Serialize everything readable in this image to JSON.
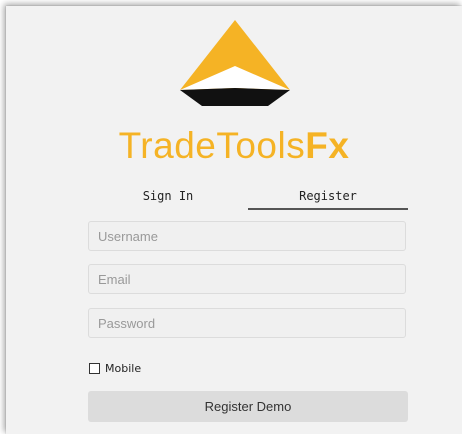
{
  "brand": {
    "name_regular": "TradeTools",
    "name_bold": "Fx",
    "color": "#f5b325"
  },
  "logo": {
    "icon": "pyramid-logo-icon",
    "colors": [
      "#f5b325",
      "#ffffff",
      "#111111"
    ]
  },
  "tabs": [
    {
      "label": "Sign In",
      "active": false
    },
    {
      "label": "Register",
      "active": true
    }
  ],
  "form": {
    "username": {
      "placeholder": "Username",
      "value": ""
    },
    "email": {
      "placeholder": "Email",
      "value": ""
    },
    "password": {
      "placeholder": "Password",
      "value": ""
    },
    "mobile": {
      "label": "Mobile",
      "checked": false
    },
    "submit_label": "Register Demo"
  }
}
